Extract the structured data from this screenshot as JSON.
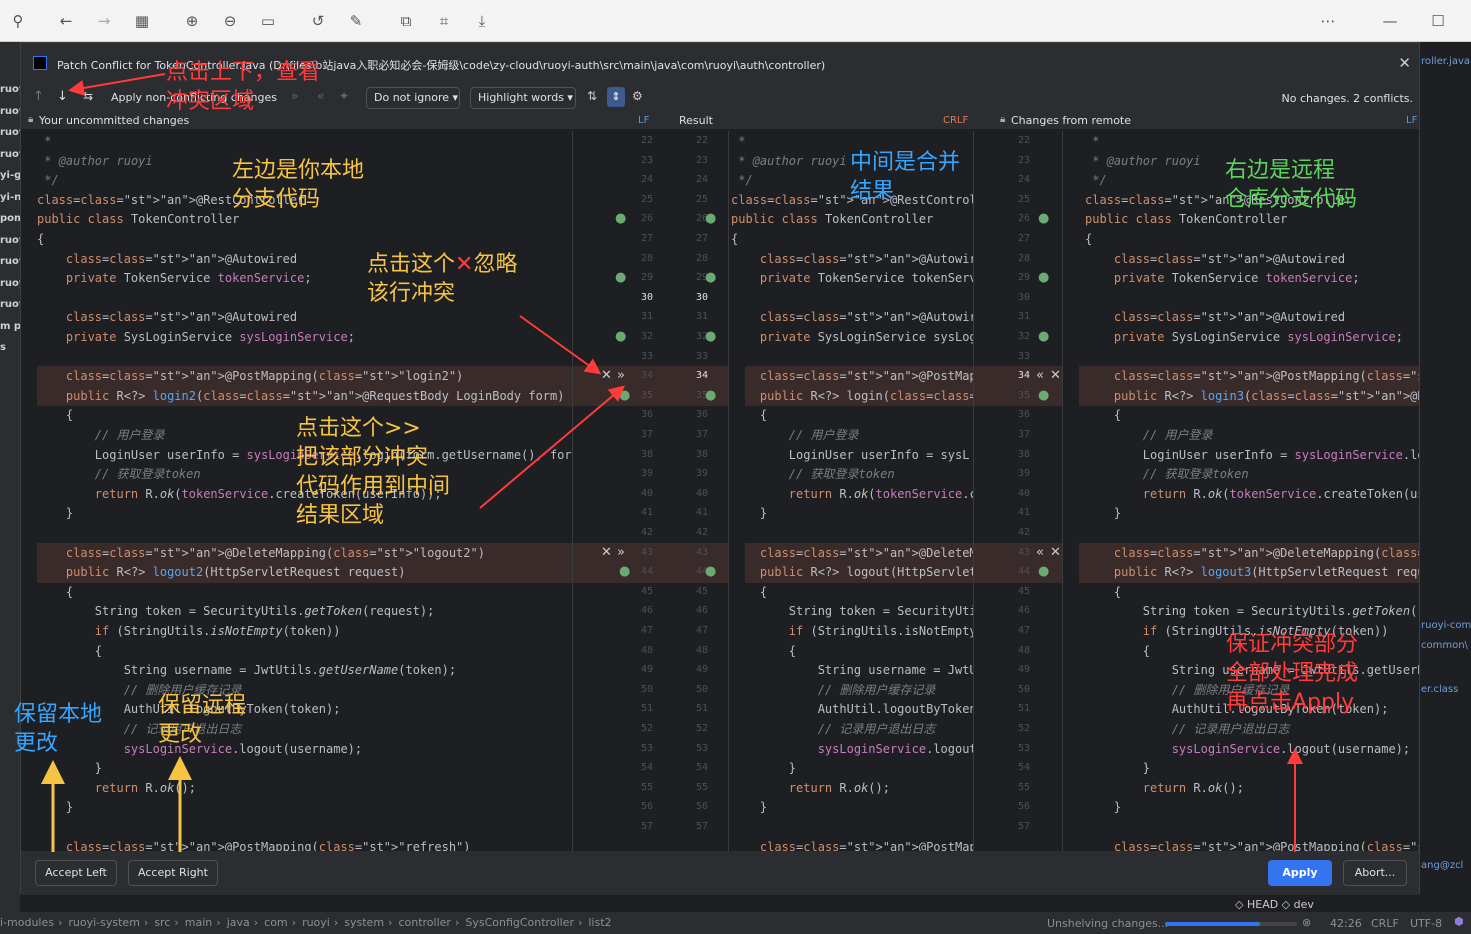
{
  "dialog": {
    "title": "Patch Conflict for TokenController.java (D:\\files\\b站java入职必知必会-保姆级\\code\\zy-cloud\\ruoyi-auth\\src\\main\\java\\com\\ruoyi\\auth\\controller)",
    "toolbar": {
      "apply_non_conflicting": "Apply non-conflicting changes",
      "ignore_dropdown": "Do not ignore",
      "highlight_dropdown": "Highlight words",
      "status": "No changes. 2 conflicts."
    },
    "headers": {
      "left": "Your uncommitted changes",
      "left_sep": "LF",
      "middle": "Result",
      "middle_sep": "CRLF",
      "right": "Changes from remote",
      "right_sep": "LF"
    },
    "buttons": {
      "accept_left": "Accept Left",
      "accept_right": "Accept Right",
      "apply": "Apply",
      "abort": "Abort..."
    }
  },
  "code": {
    "left": [
      " *",
      " * @author ruoyi",
      " */",
      "@RestController",
      "public class TokenController",
      "{",
      "    @Autowired",
      "    private TokenService tokenService;",
      "",
      "    @Autowired",
      "    private SysLoginService sysLoginService;",
      "",
      "    @PostMapping(\"login2\")",
      "    public R<?> login2(@RequestBody LoginBody form)",
      "    {",
      "        // 用户登录",
      "        LoginUser userInfo = sysLoginService.login(form.getUsername(), form",
      "        // 获取登录token",
      "        return R.ok(tokenService.createToken(userInfo));",
      "    }",
      "",
      "    @DeleteMapping(\"logout2\")",
      "    public R<?> logout2(HttpServletRequest request)",
      "    {",
      "        String token = SecurityUtils.getToken(request);",
      "        if (StringUtils.isNotEmpty(token))",
      "        {",
      "            String username = JwtUtils.getUserName(token);",
      "            // 删除用户缓存记录",
      "            AuthUtil.logoutByToken(token);",
      "            // 记录用户退出日志",
      "            sysLoginService.logout(username);",
      "        }",
      "        return R.ok();",
      "    }",
      "",
      "    @PostMapping(\"refresh\")"
    ],
    "middle": [
      " *",
      " * @author ruoyi",
      " */",
      "@RestController",
      "public class TokenController",
      "{",
      "    @Autowired",
      "    private TokenService tokenServ",
      "",
      "    @Autowired",
      "    private SysLoginService sysLog",
      "",
      "    @PostMapping(\"login\")",
      "    public R<?> login(@RequestBody",
      "    {",
      "        // 用户登录",
      "        LoginUser userInfo = sysL",
      "        // 获取登录token",
      "        return R.ok(tokenService.c",
      "    }",
      "",
      "    @DeleteMapping(\"logout\")",
      "    public R<?> logout(HttpServlet",
      "    {",
      "        String token = SecurityUti",
      "        if (StringUtils.isNotEmpty",
      "        {",
      "            String username = JwtU",
      "            // 删除用户缓存记录",
      "            AuthUtil.logoutByToken",
      "            // 记录用户退出日志",
      "            sysLoginService.logout",
      "        }",
      "        return R.ok();",
      "    }",
      "",
      "    @PostMapping(\"refresh\")"
    ],
    "right": [
      " *",
      " * @author ruoyi",
      " */",
      "@RestController",
      "public class TokenController",
      "{",
      "    @Autowired",
      "    private TokenService tokenService;",
      "",
      "    @Autowired",
      "    private SysLoginService sysLoginService;",
      "",
      "    @PostMapping(\"login3\")",
      "    public R<?> login3(@RequestBody LoginBody form",
      "    {",
      "        // 用户登录",
      "        LoginUser userInfo = sysLoginService.login",
      "        // 获取登录token",
      "        return R.ok(tokenService.createToken(userI",
      "    }",
      "",
      "    @DeleteMapping(\"logout3\")",
      "    public R<?> logout3(HttpServletRequest request",
      "    {",
      "        String token = SecurityUtils.getToken(requ",
      "        if (StringUtils.isNotEmpty(token))",
      "        {",
      "            String username = JwtUtils.getUserName",
      "            // 删除用户缓存记录",
      "            AuthUtil.logoutByToken(token);",
      "            // 记录用户退出日志",
      "            sysLoginService.logout(username);",
      "        }",
      "        return R.ok();",
      "    }",
      "",
      "    @PostMapping(\"refresh\")"
    ],
    "line_numbers_start": 22,
    "line_numbers_end": 57
  },
  "annotations": {
    "nav": "点击上下，查看\n冲突区域",
    "left": "左边是你本地\n分支代码",
    "middle": "中间是合并\n结果",
    "right": "右边是远程\n仓库分支代码",
    "ignore": "点击这个",
    "ignore_mark": "✕",
    "ignore_rest": "忽略",
    "ignore_line2": "该行冲突",
    "apply_part": "点击这个>>\n把该部分冲突\n代码作用到中间\n结果区域",
    "keep_local": "保留本地\n更改",
    "keep_remote": "保留远程\n更改",
    "finish": "保证冲突部分\n全部处理完成\n再点击Apply"
  },
  "status_bar": {
    "path": [
      "i-modules",
      "ruoyi-system",
      "src",
      "main",
      "java",
      "com",
      "ruoyi",
      "system",
      "controller",
      "SysConfigController",
      "list2"
    ],
    "progress_label": "Unshelving changes...",
    "position": "42:26",
    "line_sep": "CRLF",
    "encoding": "UTF-8",
    "vcs": "HEAD",
    "branch": "dev"
  },
  "ide_left_labels": [
    "ruoy",
    "ruoy",
    "ruoy",
    "ruoy",
    "yi-g",
    "yi-n",
    "pom",
    "ruoy",
    "ruoy",
    "ruoy",
    "ruoy",
    "m p",
    "s",
    "",
    ""
  ],
  "ide_right_labels": [
    "roller.java",
    "ruoyi-com",
    "common\\",
    "er.class",
    "ang@zcl"
  ],
  "colors": {
    "accent": "#3574f0",
    "conflict_bg": "#3a2b2b",
    "annotation_red": "#ff3b3b"
  }
}
